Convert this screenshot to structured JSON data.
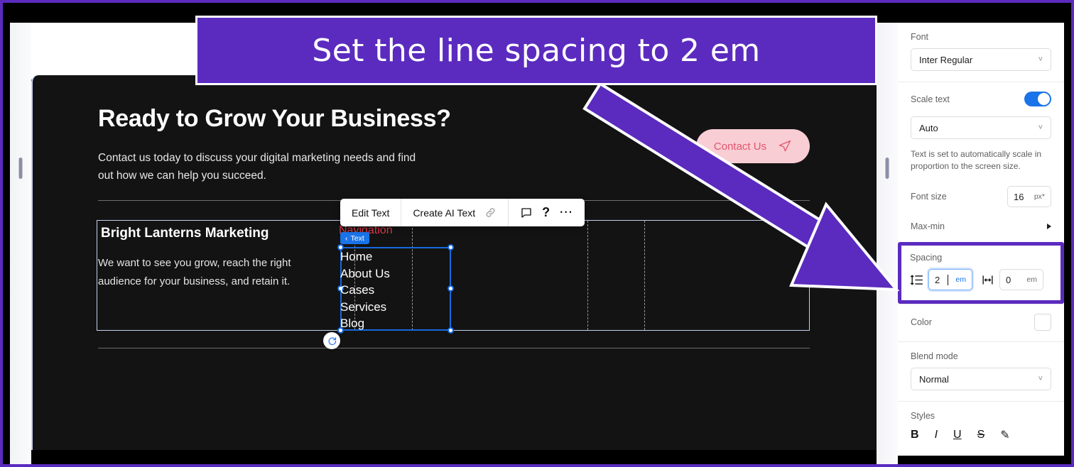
{
  "annotation": {
    "banner_text": "Set the line spacing to 2 em",
    "banner_color": "#5B2BBF",
    "arrow_color": "#5B2BBF",
    "highlight_target": "Spacing"
  },
  "canvas": {
    "headline": "Ready to Grow Your Business?",
    "subtext_line1": "Contact us today to discuss your digital marketing needs and find",
    "subtext_line2": "out how we can help you succeed.",
    "cta": {
      "label": "Contact Us",
      "icon": "paper-plane-icon",
      "bg": "#F9CDD4",
      "fg": "#E0566E"
    },
    "footer_title": "Bright Lanterns Marketing",
    "footer_line1": "We want to see you grow, reach the right",
    "footer_line2": "audience for your business, and retain it.",
    "selection": {
      "element_label": "Navigation",
      "badge": "Text",
      "badge_chevron": "‹",
      "items": [
        "Home",
        "About Us",
        "Cases",
        "Services",
        "Blog"
      ],
      "rotate_icon": "rotate-icon",
      "selection_color": "#1769E0",
      "label_color": "#E03A4E"
    }
  },
  "context_toolbar": {
    "edit_text": "Edit Text",
    "create_ai_text": "Create AI Text",
    "link_icon": "link-icon",
    "comment_icon": "comment-icon",
    "help_icon": "help-icon",
    "more_icon": "more-icon"
  },
  "panel": {
    "font": {
      "label": "Font",
      "value": "Inter Regular"
    },
    "scale_text": {
      "label": "Scale text",
      "enabled": true,
      "toggle_color": "#1A73E8"
    },
    "scale_mode": {
      "value": "Auto"
    },
    "scale_hint": "Text is set to automatically scale in proportion to the screen size.",
    "font_size": {
      "label": "Font size",
      "value": "16",
      "unit": "px*"
    },
    "max_min": {
      "label": "Max-min",
      "expand_icon": "triangle-right-icon"
    },
    "spacing": {
      "label": "Spacing",
      "line_height": {
        "icon": "line-height-icon",
        "value": "2",
        "unit": "em",
        "focused": true
      },
      "letter_spacing": {
        "icon": "letter-spacing-icon",
        "value": "0",
        "unit": "em"
      }
    },
    "color": {
      "label": "Color",
      "swatch": "#FFFFFF"
    },
    "blend_mode": {
      "label": "Blend mode",
      "value": "Normal"
    },
    "styles": {
      "label": "Styles",
      "buttons": [
        {
          "name": "bold-icon",
          "glyph": "B"
        },
        {
          "name": "italic-icon",
          "glyph": "I"
        },
        {
          "name": "underline-icon",
          "glyph": "U"
        },
        {
          "name": "strikethrough-icon",
          "glyph": "S"
        },
        {
          "name": "text-edit-icon",
          "glyph": "✎"
        }
      ]
    }
  }
}
